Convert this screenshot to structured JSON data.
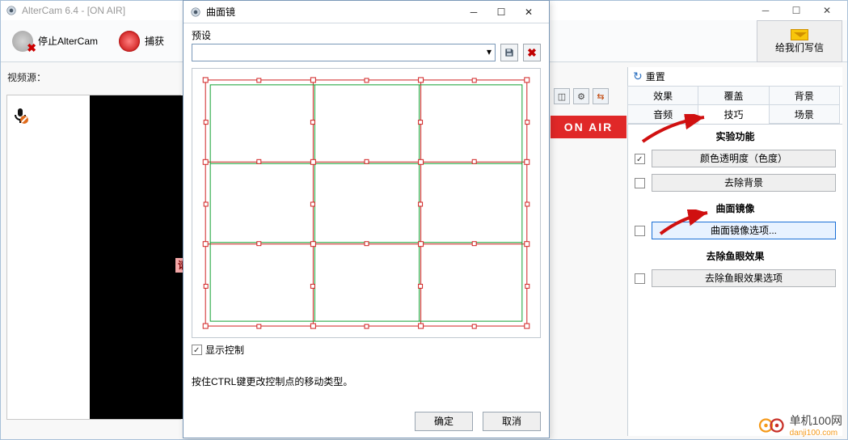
{
  "main": {
    "title": "AlterCam 6.4 - [ON AIR]",
    "toolbar": {
      "stop_label": "停止AlterCam",
      "capture_label": "捕获"
    },
    "feedback_label": "给我们写信",
    "video_source_label": "视频源：",
    "truncated_text": "请",
    "onair_text": "ON AIR"
  },
  "tiny_icons": {
    "crop": "crop-icon",
    "gear": "gear-icon",
    "swap": "arrows-icon"
  },
  "right": {
    "reset_label": "重置",
    "tabs": [
      "效果",
      "覆盖",
      "背景",
      "音频",
      "技巧",
      "场景"
    ],
    "active_tab_index": 4,
    "section_experimental": "实验功能",
    "opt_chroma": "颜色透明度（色度）",
    "opt_remove_bg": "去除背景",
    "section_curved": "曲面镜像",
    "opt_curved_options": "曲面镜像选项...",
    "section_fisheye": "去除鱼眼效果",
    "opt_fisheye_options": "去除鱼眼效果选项",
    "checked_chroma": true
  },
  "dialog": {
    "title": "曲面镜",
    "preset_label": "预设",
    "preset_value": "",
    "show_control_label": "显示控制",
    "show_control_checked": true,
    "hint": "按住CTRL键更改控制点的移动类型。",
    "ok_label": "确定",
    "cancel_label": "取消"
  },
  "watermark": {
    "line1": "单机100网",
    "line2": "danji100.com"
  }
}
